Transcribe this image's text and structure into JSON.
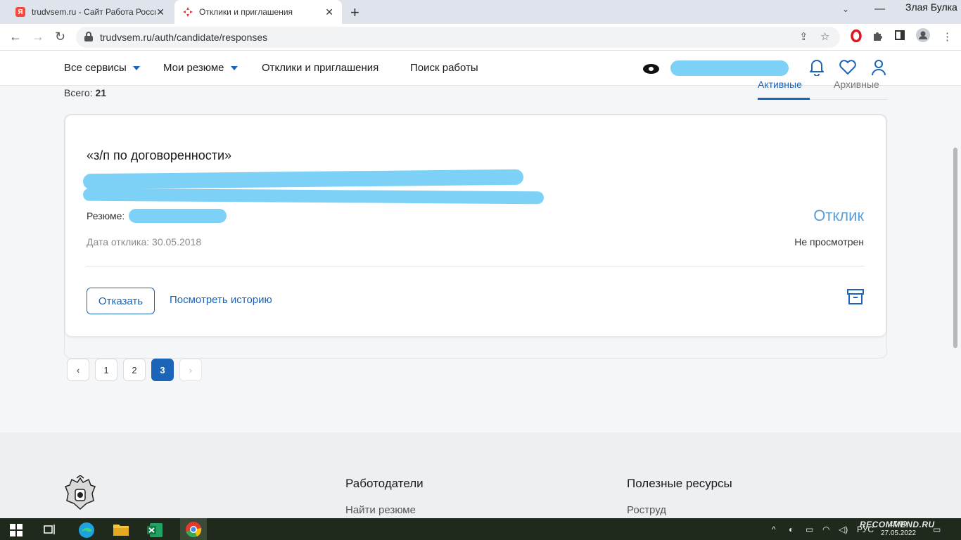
{
  "browser": {
    "tabs": [
      {
        "title": "trudvsem.ru - Сайт Работа России",
        "favicon": "yandex-icon",
        "active": false
      },
      {
        "title": "Отклики и приглашения",
        "favicon": "trudvsem-logo-icon",
        "active": true
      }
    ],
    "profile_name": "Злая Булка",
    "url": "trudvsem.ru/auth/candidate/responses"
  },
  "header": {
    "nav": [
      "Все сервисы",
      "Мои резюме",
      "Отклики и приглашения",
      "Поиск работы"
    ]
  },
  "main": {
    "total_label": "Всего:",
    "total_value": "21",
    "tabs": [
      "Активные",
      "Архивные"
    ],
    "response": {
      "salary": "«з/п по договоренности»",
      "resume_label": "Резюме:",
      "date_label": "Дата отклика: 30.05.2018",
      "type": "Отклик",
      "status": "Не просмотрен",
      "decline_label": "Отказать",
      "history_label": "Посмотреть историю"
    },
    "pagination": {
      "prev": "‹",
      "next": "›",
      "pages": [
        "1",
        "2",
        "3"
      ],
      "current": "3"
    }
  },
  "footer": {
    "col1": {
      "heading": "Работодатели",
      "link": "Найти резюме"
    },
    "col2": {
      "heading": "Полезные ресурсы",
      "link": "Роструд"
    }
  },
  "taskbar": {
    "lang": "РУС",
    "time": "17:09",
    "date": "27.05.2022"
  },
  "watermark": "RECOMMEND.RU",
  "colors": {
    "accent": "#1b64b7",
    "status_link": "#5b9ed8",
    "redaction": "#7dd1f7"
  }
}
